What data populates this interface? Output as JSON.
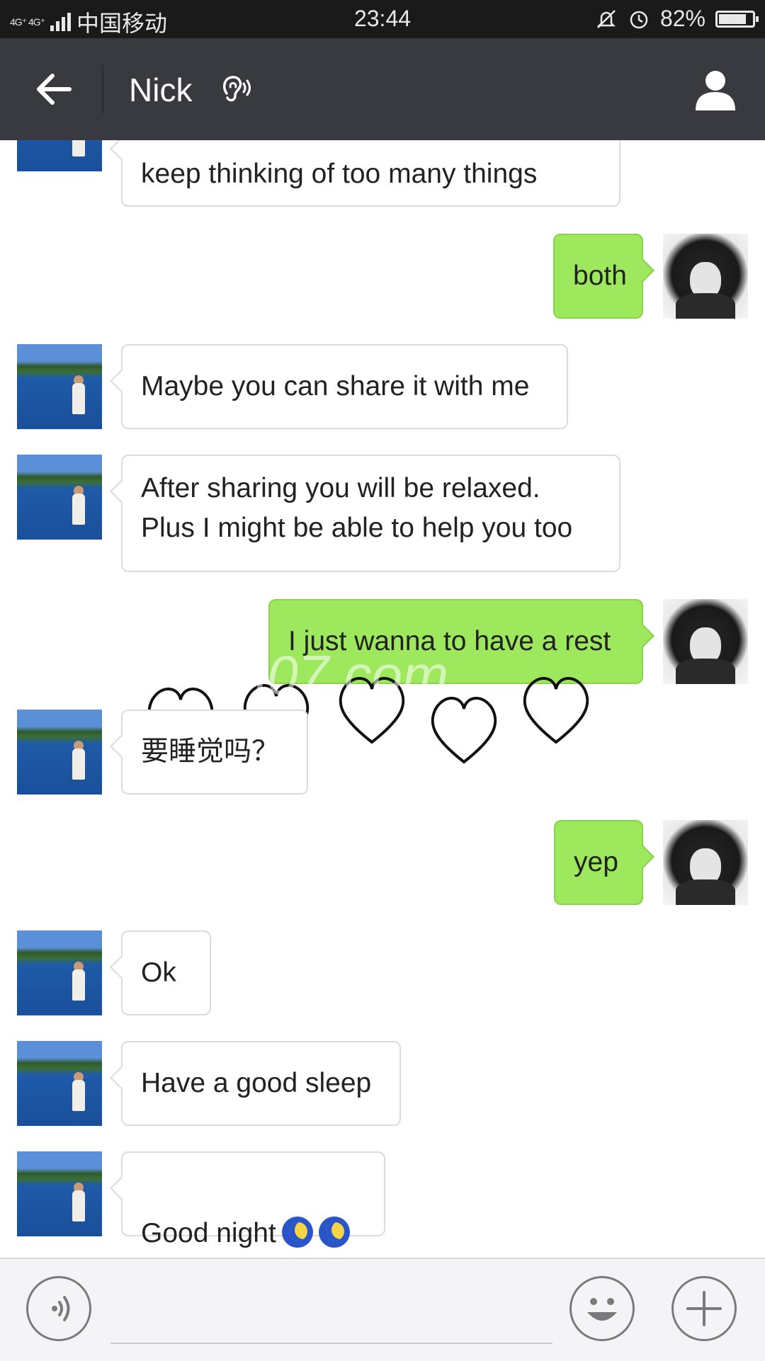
{
  "status_bar": {
    "network": "4G⁺ 4G⁺",
    "carrier": "中国移动",
    "time": "23:44",
    "battery_text": "82%",
    "battery_level": 0.82,
    "icons": [
      "mute-bell-icon",
      "alarm-icon"
    ]
  },
  "header": {
    "back_icon": "back-arrow-icon",
    "contact_name": "Nick",
    "ear_icon": "earpiece-mode-icon",
    "profile_icon": "person-icon"
  },
  "messages": [
    {
      "side": "in",
      "text": "keep thinking of too many things"
    },
    {
      "side": "out",
      "text": "both"
    },
    {
      "side": "in",
      "text": "Maybe you can share it with me"
    },
    {
      "side": "in",
      "text": "After sharing you will be relaxed.\nPlus I might be able to help you too"
    },
    {
      "side": "out",
      "text": "I just wanna  to have a rest"
    },
    {
      "side": "in",
      "text": "要睡觉吗？"
    },
    {
      "side": "out",
      "text": "yep"
    },
    {
      "side": "in",
      "text": "Ok"
    },
    {
      "side": "in",
      "text": "Have a good sleep"
    },
    {
      "side": "in",
      "text": "Good night",
      "emoji": [
        "sleeping-moon-emoji",
        "sleeping-moon-emoji"
      ]
    }
  ],
  "decorations": {
    "hearts_count": 5
  },
  "watermark": "i07.com",
  "input_bar": {
    "voice_icon": "voice-input-icon",
    "emoji_icon": "smiley-icon",
    "plus_icon": "plus-icon"
  },
  "colors": {
    "header_bg": "#393a3f",
    "outgoing_bubble": "#9ee85e",
    "incoming_bubble": "#ffffff"
  }
}
